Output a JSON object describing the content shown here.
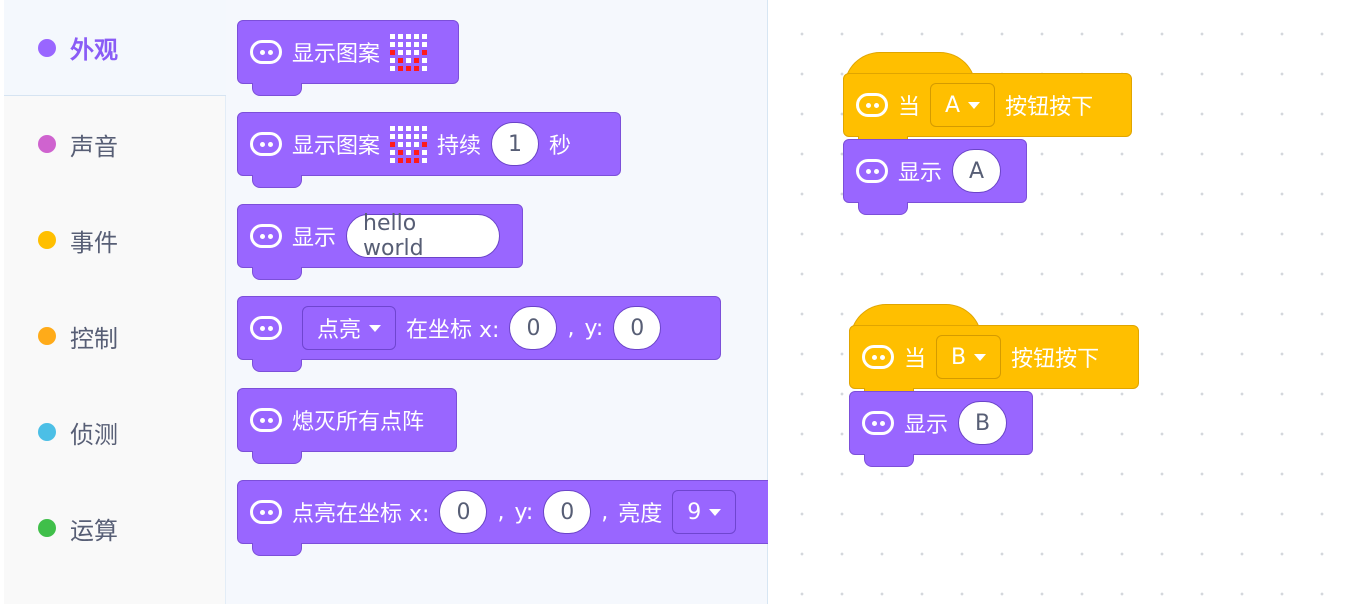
{
  "sidebar": {
    "categories": [
      {
        "label": "外观",
        "color": "#9966ff",
        "active": true
      },
      {
        "label": "声音",
        "color": "#cf63cf"
      },
      {
        "label": "事件",
        "color": "#ffbf00"
      },
      {
        "label": "控制",
        "color": "#ffab19"
      },
      {
        "label": "侦测",
        "color": "#4cbfe6"
      },
      {
        "label": "运算",
        "color": "#40bf4a"
      }
    ]
  },
  "flyout": {
    "show_pattern": {
      "label": "显示图案"
    },
    "show_pattern_for": {
      "label": "显示图案",
      "for": "持续",
      "secs": "1",
      "unit": "秒"
    },
    "show_text": {
      "label": "显示",
      "value": "hello world"
    },
    "plot": {
      "option": "点亮",
      "at": "在坐标 x:",
      "x": "0",
      "comma": ",",
      "y_label": "y:",
      "y": "0"
    },
    "clear": {
      "label": "熄灭所有点阵"
    },
    "plot_brightness": {
      "label": "点亮在坐标 x:",
      "x": "0",
      "comma1": ",",
      "y_label": "y:",
      "y": "0",
      "comma2": ",",
      "brightness_label": "亮度",
      "brightness": "9"
    }
  },
  "workspace": {
    "script_a": {
      "when": "当",
      "button": "A",
      "pressed": "按钮按下",
      "show": "显示",
      "value": "A"
    },
    "script_b": {
      "when": "当",
      "button": "B",
      "pressed": "按钮按下",
      "show": "显示",
      "value": "B"
    }
  },
  "colors": {
    "looks": "#9966ff",
    "events": "#ffbf00",
    "led_on": "#ff1a1a"
  }
}
